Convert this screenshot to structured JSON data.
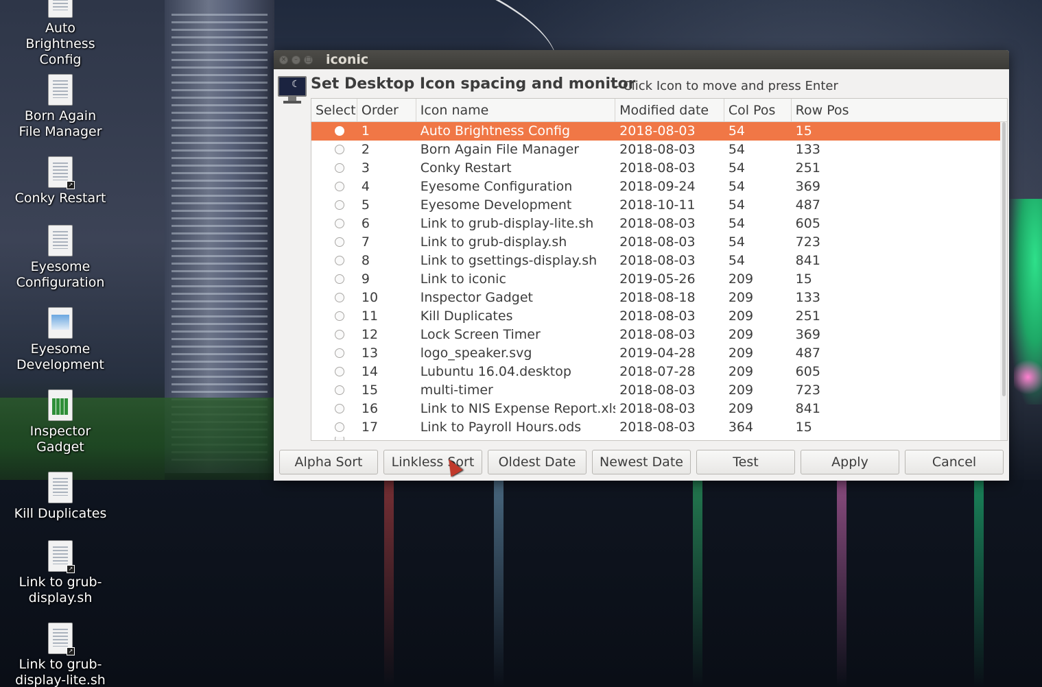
{
  "window": {
    "title": "iconic",
    "heading": "Set Desktop Icon spacing and monitor",
    "subheading": " - Click Icon to move and press Enter"
  },
  "table": {
    "columns": [
      "Select",
      "Order",
      "Icon name",
      "Modified date",
      "Col Pos",
      "Row Pos"
    ],
    "rows": [
      {
        "order": "1",
        "name": "Auto Brightness Config",
        "date": "2018-08-03",
        "col": "54",
        "row": "15"
      },
      {
        "order": "2",
        "name": "Born Again File Manager",
        "date": "2018-08-03",
        "col": "54",
        "row": "133"
      },
      {
        "order": "3",
        "name": "Conky Restart",
        "date": "2018-08-03",
        "col": "54",
        "row": "251"
      },
      {
        "order": "4",
        "name": "Eyesome Configuration",
        "date": "2018-09-24",
        "col": "54",
        "row": "369"
      },
      {
        "order": "5",
        "name": "Eyesome Development",
        "date": "2018-10-11",
        "col": "54",
        "row": "487"
      },
      {
        "order": "6",
        "name": "Link to grub-display-lite.sh",
        "date": "2018-08-03",
        "col": "54",
        "row": "605"
      },
      {
        "order": "7",
        "name": "Link to grub-display.sh",
        "date": "2018-08-03",
        "col": "54",
        "row": "723"
      },
      {
        "order": "8",
        "name": "Link to gsettings-display.sh",
        "date": "2018-08-03",
        "col": "54",
        "row": "841"
      },
      {
        "order": "9",
        "name": "Link to iconic",
        "date": "2019-05-26",
        "col": "209",
        "row": "15"
      },
      {
        "order": "10",
        "name": "Inspector Gadget",
        "date": "2018-08-18",
        "col": "209",
        "row": "133"
      },
      {
        "order": "11",
        "name": "Kill Duplicates",
        "date": "2018-08-03",
        "col": "209",
        "row": "251"
      },
      {
        "order": "12",
        "name": "Lock Screen Timer",
        "date": "2018-08-03",
        "col": "209",
        "row": "369"
      },
      {
        "order": "13",
        "name": "logo_speaker.svg",
        "date": "2019-04-28",
        "col": "209",
        "row": "487"
      },
      {
        "order": "14",
        "name": "Lubuntu 16.04.desktop",
        "date": "2018-07-28",
        "col": "209",
        "row": "605"
      },
      {
        "order": "15",
        "name": "multi-timer",
        "date": "2018-08-03",
        "col": "209",
        "row": "723"
      },
      {
        "order": "16",
        "name": "Link to NIS Expense Report.xlsx",
        "date": "2018-08-03",
        "col": "209",
        "row": "841"
      },
      {
        "order": "17",
        "name": "Link to Payroll Hours.ods",
        "date": "2018-08-03",
        "col": "364",
        "row": "15"
      }
    ],
    "selected_index": 0,
    "selected_color": "#f07746"
  },
  "buttons": [
    "Alpha Sort",
    "Linkless Sort",
    "Oldest Date",
    "Newest Date",
    "Test",
    "Apply",
    "Cancel"
  ],
  "desktop_icons": [
    {
      "label_lines": [
        "Auto",
        "Brightness",
        "Config"
      ],
      "icon": "document-icon"
    },
    {
      "label_lines": [
        "Born Again",
        "File Manager"
      ],
      "icon": "document-icon"
    },
    {
      "label_lines": [
        "Conky Restart"
      ],
      "icon": "document-icon"
    },
    {
      "label_lines": [
        "Eyesome",
        "Configuration"
      ],
      "icon": "document-icon"
    },
    {
      "label_lines": [
        "Eyesome",
        "Development"
      ],
      "icon": "image-document-icon"
    },
    {
      "label_lines": [
        "Inspector",
        "Gadget"
      ],
      "icon": "spreadsheet-icon"
    },
    {
      "label_lines": [
        "Kill Duplicates"
      ],
      "icon": "document-icon"
    },
    {
      "label_lines": [
        "Link to grub-",
        "display.sh"
      ],
      "icon": "document-link-icon"
    },
    {
      "label_lines": [
        "Link to grub-",
        "display-lite.sh"
      ],
      "icon": "document-link-icon"
    }
  ]
}
